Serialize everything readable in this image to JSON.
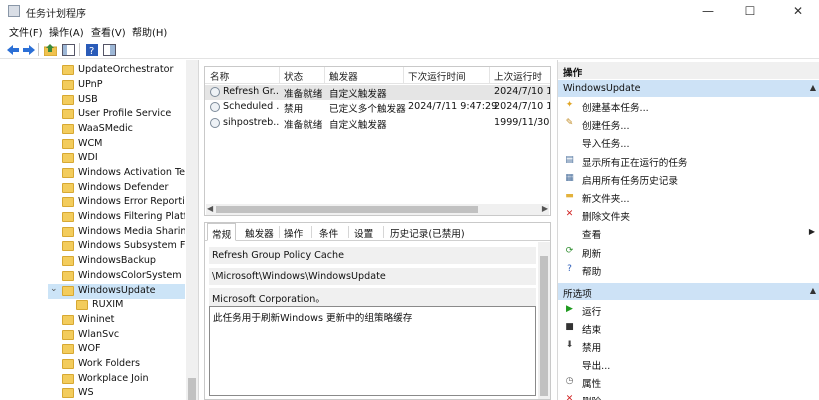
{
  "window": {
    "title": "任务计划程序",
    "minimize": "—",
    "maximize": "☐",
    "close": "✕"
  },
  "menu": [
    "文件(F)",
    "操作(A)",
    "查看(V)",
    "帮助(H)"
  ],
  "tree": {
    "items": [
      {
        "label": "UpdateOrchestrator"
      },
      {
        "label": "UPnP"
      },
      {
        "label": "USB"
      },
      {
        "label": "User Profile Service"
      },
      {
        "label": "WaaSMedic"
      },
      {
        "label": "WCM"
      },
      {
        "label": "WDI"
      },
      {
        "label": "Windows Activation Tech"
      },
      {
        "label": "Windows Defender"
      },
      {
        "label": "Windows Error Reporting"
      },
      {
        "label": "Windows Filtering Platfor"
      },
      {
        "label": "Windows Media Sharing"
      },
      {
        "label": "Windows Subsystem For"
      },
      {
        "label": "WindowsBackup"
      },
      {
        "label": "WindowsColorSystem"
      },
      {
        "label": "WindowsUpdate"
      },
      {
        "label": "RUXIM"
      },
      {
        "label": "Wininet"
      },
      {
        "label": "WlanSvc"
      },
      {
        "label": "WOF"
      },
      {
        "label": "Work Folders"
      },
      {
        "label": "Workplace Join"
      },
      {
        "label": "WS"
      }
    ],
    "expanded_glyph": "⌄"
  },
  "task_list": {
    "columns": [
      "名称",
      "状态",
      "触发器",
      "下次运行时间",
      "上次运行时"
    ],
    "rows": [
      {
        "name": "Refresh Gr...",
        "status": "准备就绪",
        "trigger": "自定义触发器",
        "next_run": "",
        "last_run": "2024/7/10 15"
      },
      {
        "name": "Scheduled ...",
        "status": "禁用",
        "trigger": "已定义多个触发器",
        "next_run": "2024/7/11 9:47:29",
        "last_run": "2024/7/10 15"
      },
      {
        "name": "sihpostreb...",
        "status": "准备就绪",
        "trigger": "自定义触发器",
        "next_run": "",
        "last_run": "1999/11/30 0"
      }
    ]
  },
  "details": {
    "tabs": [
      "常规",
      "触发器",
      "操作",
      "条件",
      "设置",
      "历史记录(已禁用)"
    ],
    "name": "Refresh Group Policy Cache",
    "location": "\\Microsoft\\Windows\\WindowsUpdate",
    "author": "Microsoft Corporation。",
    "description": "此任务用于刷新Windows 更新中的组策略缓存"
  },
  "actions": {
    "heading": "操作",
    "section1": "WindowsUpdate",
    "items1": [
      {
        "label": "创建基本任务...",
        "icon": "create-basic-task-icon",
        "glyph": "✦",
        "color": "#e0a526"
      },
      {
        "label": "创建任务...",
        "icon": "create-task-icon",
        "glyph": "✎",
        "color": "#c08a22"
      },
      {
        "label": "导入任务...",
        "icon": "import-task-icon",
        "glyph": "",
        "color": "#555555"
      },
      {
        "label": "显示所有正在运行的任务",
        "icon": "running-tasks-icon",
        "glyph": "▤",
        "color": "#4a6f9c"
      },
      {
        "label": "启用所有任务历史记录",
        "icon": "history-icon",
        "glyph": "▦",
        "color": "#4a6f9c"
      },
      {
        "label": "新文件夹...",
        "icon": "new-folder-icon",
        "glyph": "▬",
        "color": "#e3b23c"
      },
      {
        "label": "删除文件夹",
        "icon": "delete-folder-icon",
        "glyph": "✕",
        "color": "#d02020"
      },
      {
        "label": "查看",
        "icon": "view-icon",
        "glyph": "",
        "color": "#555555",
        "submenu": "▶"
      },
      {
        "label": "刷新",
        "icon": "refresh-icon",
        "glyph": "⟳",
        "color": "#2a8a2a"
      },
      {
        "label": "帮助",
        "icon": "help-icon",
        "glyph": "?",
        "color": "#2a5bb8"
      }
    ],
    "section2": "所选项",
    "items2": [
      {
        "label": "运行",
        "icon": "run-icon",
        "glyph": "▶",
        "color": "#1e9a1e"
      },
      {
        "label": "结束",
        "icon": "end-icon",
        "glyph": "■",
        "color": "#333333"
      },
      {
        "label": "禁用",
        "icon": "disable-icon",
        "glyph": "⬇",
        "color": "#444444"
      },
      {
        "label": "导出...",
        "icon": "export-icon",
        "glyph": "",
        "color": "#555555"
      },
      {
        "label": "属性",
        "icon": "properties-icon",
        "glyph": "◷",
        "color": "#666666"
      },
      {
        "label": "删除",
        "icon": "delete-icon",
        "glyph": "✕",
        "color": "#d02020"
      }
    ],
    "collapse_glyph": "▲"
  }
}
